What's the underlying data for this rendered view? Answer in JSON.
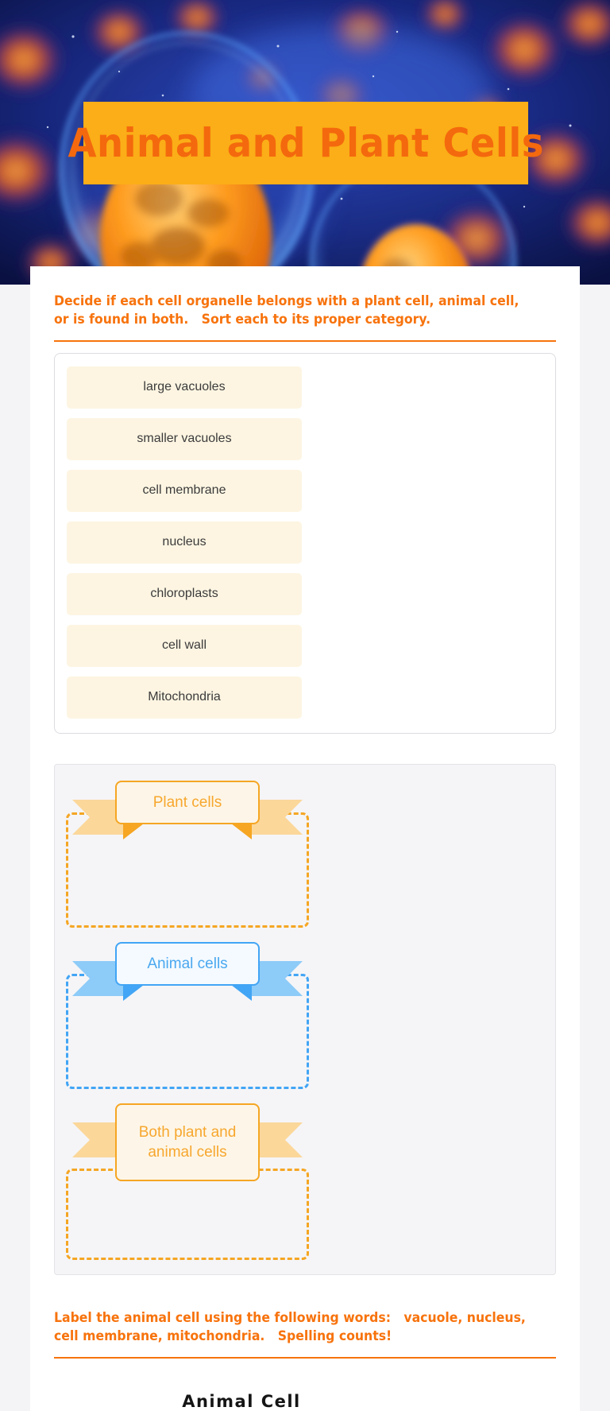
{
  "header": {
    "banner_title": "Animal and Plant Cells",
    "banner_bg_color": "#fbae17",
    "banner_text_color": "#f4690d",
    "image_alt": "microscopic-cells-illustration"
  },
  "instructions": {
    "sort_activity": "Decide if each cell organelle belongs with a plant cell, animal cell, or is found in both.   Sort each to its proper category.",
    "label_activity": "Label the animal cell using the following words:   vacuole, nucleus, cell membrane, mitochondria.   Spelling counts!",
    "accent_color": "#f7730d"
  },
  "word_tiles": [
    {
      "label": "large vacuoles"
    },
    {
      "label": "smaller vacuoles"
    },
    {
      "label": "cell membrane"
    },
    {
      "label": "nucleus"
    },
    {
      "label": "chloroplasts"
    },
    {
      "label": "cell wall"
    },
    {
      "label": "Mitochondria"
    }
  ],
  "categories": [
    {
      "label": "Plant cells",
      "color": "#f5a623",
      "theme": "orange"
    },
    {
      "label": "Animal cells",
      "color": "#42a5f5",
      "theme": "blue"
    },
    {
      "label": "Both plant and animal cells",
      "color": "#f5a623",
      "theme": "orange"
    }
  ],
  "diagram": {
    "title": "Animal  Cell"
  }
}
